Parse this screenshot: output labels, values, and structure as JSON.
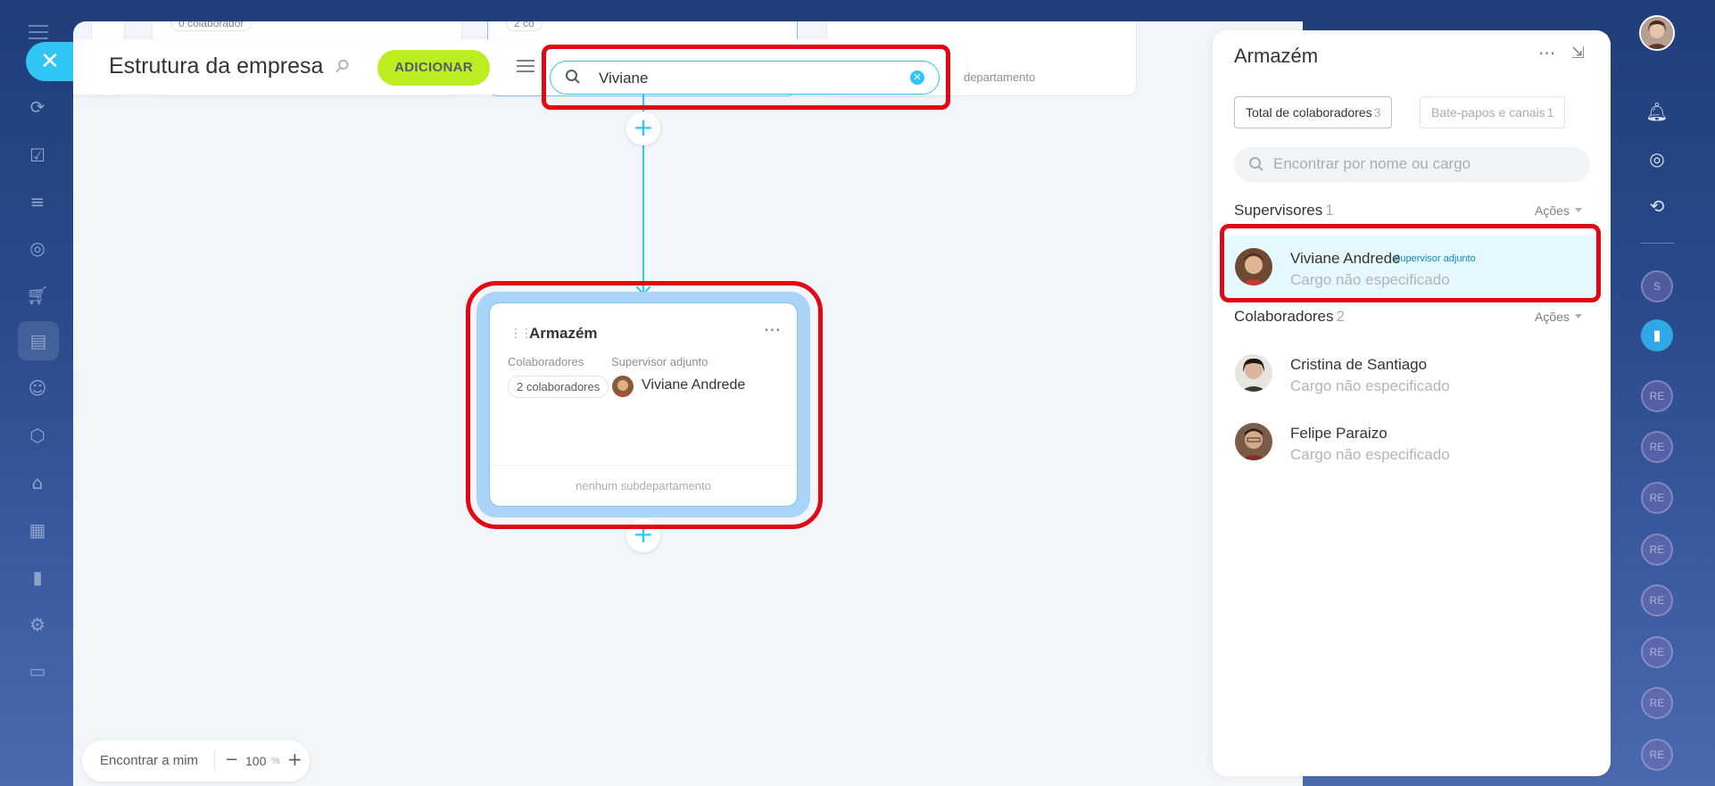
{
  "left_nav": {
    "close_icon": "✕",
    "icons": [
      "activity-stream-icon",
      "tasks-icon",
      "crm-funnel-icon",
      "goals-icon",
      "shop-icon",
      "company-structure-icon",
      "robot-icon",
      "catalog-icon",
      "warehouse-icon",
      "calendar-icon",
      "analytics-icon",
      "settings-icon",
      "docs-icon"
    ]
  },
  "background_cards": {
    "chip_0": "0 colaborador",
    "chip_1": "2 co",
    "subdept_text": "subdepartamento"
  },
  "toolbar": {
    "title": "Estrutura da empresa",
    "add_label": "ADICIONAR",
    "search_value": "Viviane"
  },
  "node": {
    "title": "Armazém",
    "employees_label": "Colaboradores",
    "employees_count": "2 colaboradores",
    "supervisor_label": "Supervisor adjunto",
    "supervisor_name": "Viviane Andrede",
    "footer": "nenhum subdepartamento"
  },
  "bottom_bar": {
    "find_me": "Encontrar a mim",
    "zoom_minus": "−",
    "zoom_value": "100",
    "zoom_unit": "%",
    "zoom_plus": "+"
  },
  "panel": {
    "title": "Armazém",
    "tabs": [
      {
        "label": "Total de colaboradores",
        "count": "3"
      },
      {
        "label": "Bate-papos e canais",
        "count": "1"
      }
    ],
    "search_placeholder": "Encontrar por nome ou cargo",
    "supervisors": {
      "title": "Supervisores",
      "count": "1",
      "actions": "Ações",
      "items": [
        {
          "name": "Viviane Andrede",
          "badge": "Supervisor adjunto",
          "position": "Cargo não especificado"
        }
      ]
    },
    "employees": {
      "title": "Colaboradores",
      "count": "2",
      "actions": "Ações",
      "items": [
        {
          "name": "Cristina de Santiago",
          "position": "Cargo não especificado"
        },
        {
          "name": "Felipe Paraizo",
          "position": "Cargo não especificado"
        }
      ]
    }
  },
  "rail": {
    "circle_s": "S",
    "circle_re": "RE"
  },
  "colors": {
    "accent": "#2fc6f6",
    "add_button": "#bbed21",
    "highlight": "#e30613",
    "selected_row": "#e5f8fd"
  }
}
